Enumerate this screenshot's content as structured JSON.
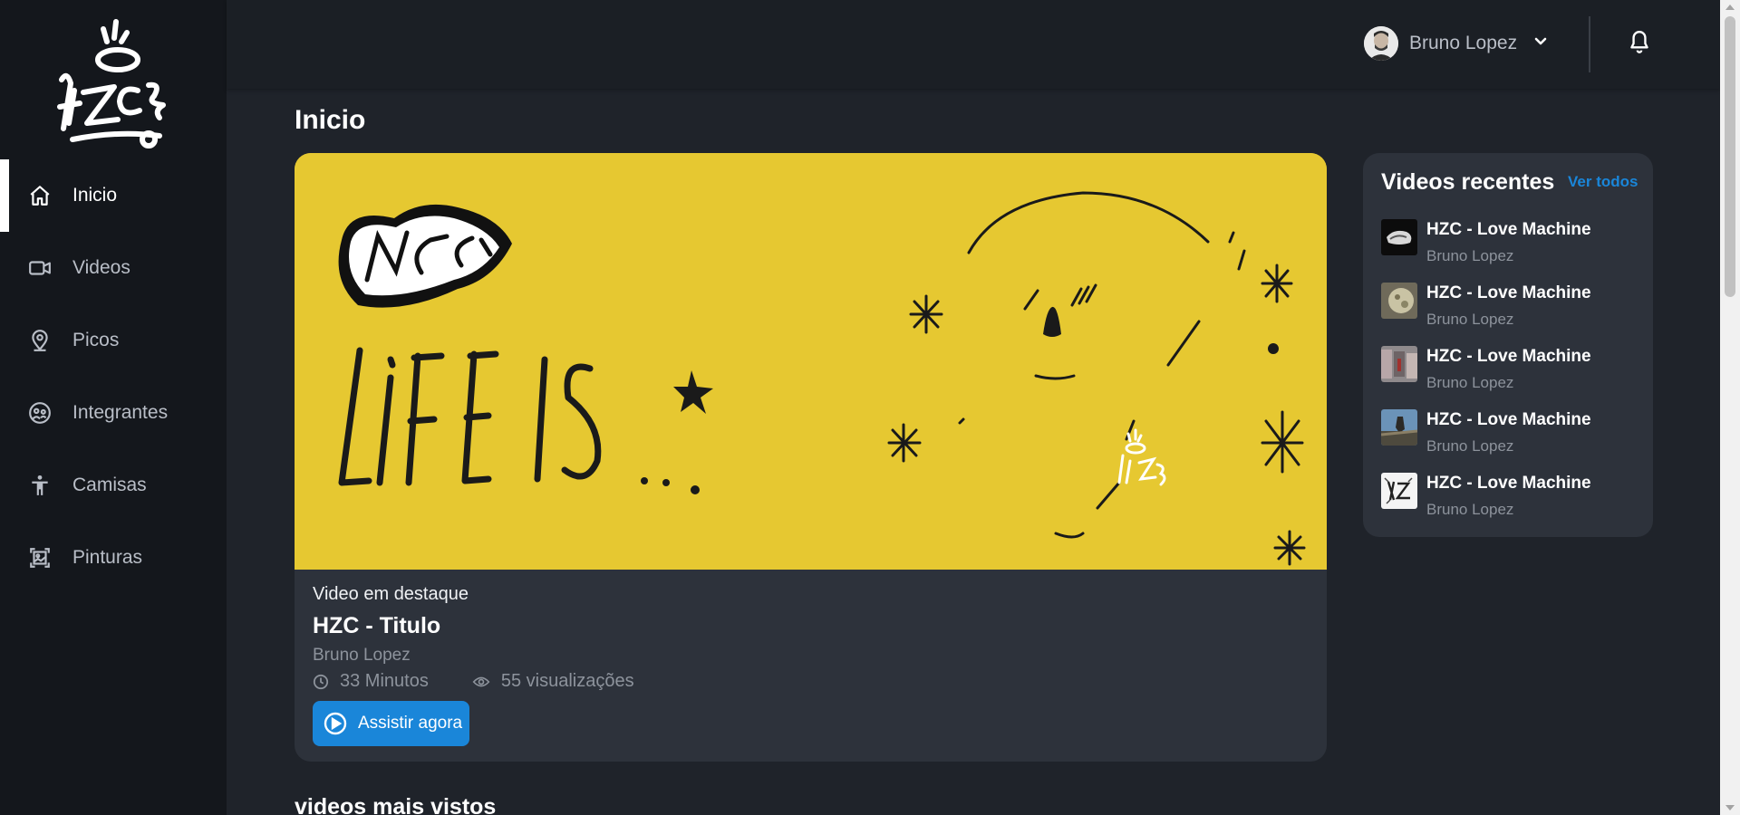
{
  "sidebar": {
    "logo_icon": "hzc-logo",
    "items": [
      {
        "label": "Inicio",
        "icon": "home-icon",
        "active": true
      },
      {
        "label": "Videos",
        "icon": "video-camera-icon"
      },
      {
        "label": "Picos",
        "icon": "map-pin-icon"
      },
      {
        "label": "Integrantes",
        "icon": "people-icon"
      },
      {
        "label": "Camisas",
        "icon": "person-icon"
      },
      {
        "label": "Pinturas",
        "icon": "picture-icon"
      }
    ]
  },
  "header": {
    "user_name": "Bruno Lopez",
    "avatar_icon": "avatar",
    "dropdown_icon": "chevron-down-icon",
    "notifications_icon": "bell-icon"
  },
  "main": {
    "page_title": "Inicio",
    "featured": {
      "kicker": "Video em destaque",
      "title": "HZC - Titulo",
      "author": "Bruno Lopez",
      "duration": "33 Minutos",
      "views": "55 visualizações",
      "watch_label": "Assistir agora",
      "thumbnail_text": "LIFE IS",
      "thumbnail_color": "#e6c831"
    },
    "recent": {
      "title": "Videos recentes",
      "see_all_label": "Ver todos",
      "items": [
        {
          "title": "HZC - Love Machine",
          "author": "Bruno Lopez"
        },
        {
          "title": "HZC - Love Machine",
          "author": "Bruno Lopez"
        },
        {
          "title": "HZC - Love Machine",
          "author": "Bruno Lopez"
        },
        {
          "title": "HZC - Love Machine",
          "author": "Bruno Lopez"
        },
        {
          "title": "HZC - Love Machine",
          "author": "Bruno Lopez"
        }
      ]
    },
    "most_viewed_title": "videos mais vistos"
  },
  "colors": {
    "accent": "#1a86d9",
    "background": "#1f232a",
    "sidebar": "#14171c",
    "card": "#2d323b"
  }
}
